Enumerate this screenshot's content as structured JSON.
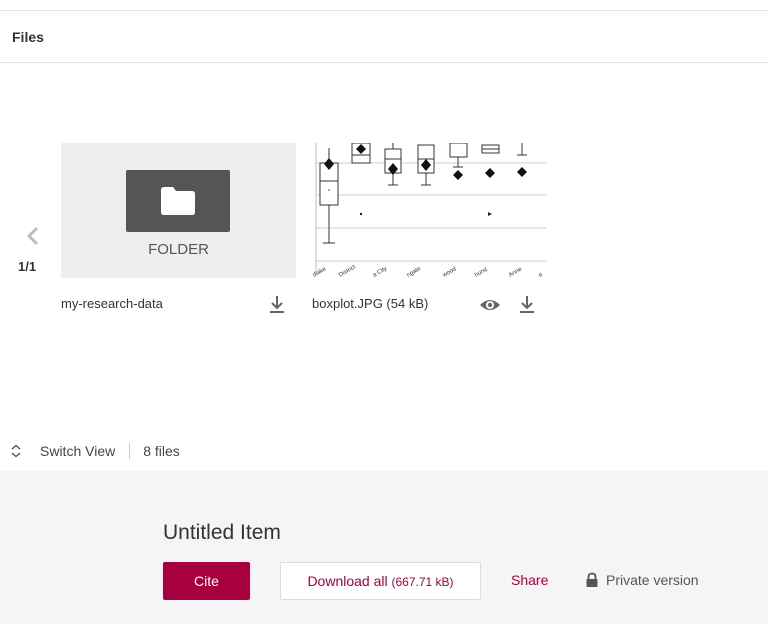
{
  "files_section": {
    "title": "Files",
    "pager": {
      "count": "1/1",
      "prev_icon": "chevron-left-icon"
    },
    "tiles": [
      {
        "type": "folder",
        "caption": "FOLDER",
        "name": "my-research-data",
        "icons": [
          "folder-icon",
          "download-icon"
        ]
      },
      {
        "type": "image",
        "name": "boxplot.JPG (54 kB)",
        "icons": [
          "eye-icon",
          "download-icon"
        ],
        "x_labels": [
          "dlake",
          "District",
          "a City",
          "ngate",
          "wood",
          "hurst",
          "Anne",
          "e"
        ]
      }
    ],
    "switch_view_label": "Switch View",
    "file_count": "8 files"
  },
  "item": {
    "title": "Untitled Item",
    "cite_label": "Cite",
    "download_all_label": "Download all",
    "download_all_size": "(667.71 kB)",
    "share_label": "Share",
    "private_label": "Private version"
  },
  "colors": {
    "accent": "#a8003f",
    "panel_bg": "#f5f5f5",
    "folder_tile_bg": "#eeeeee",
    "folder_block": "#555555"
  }
}
